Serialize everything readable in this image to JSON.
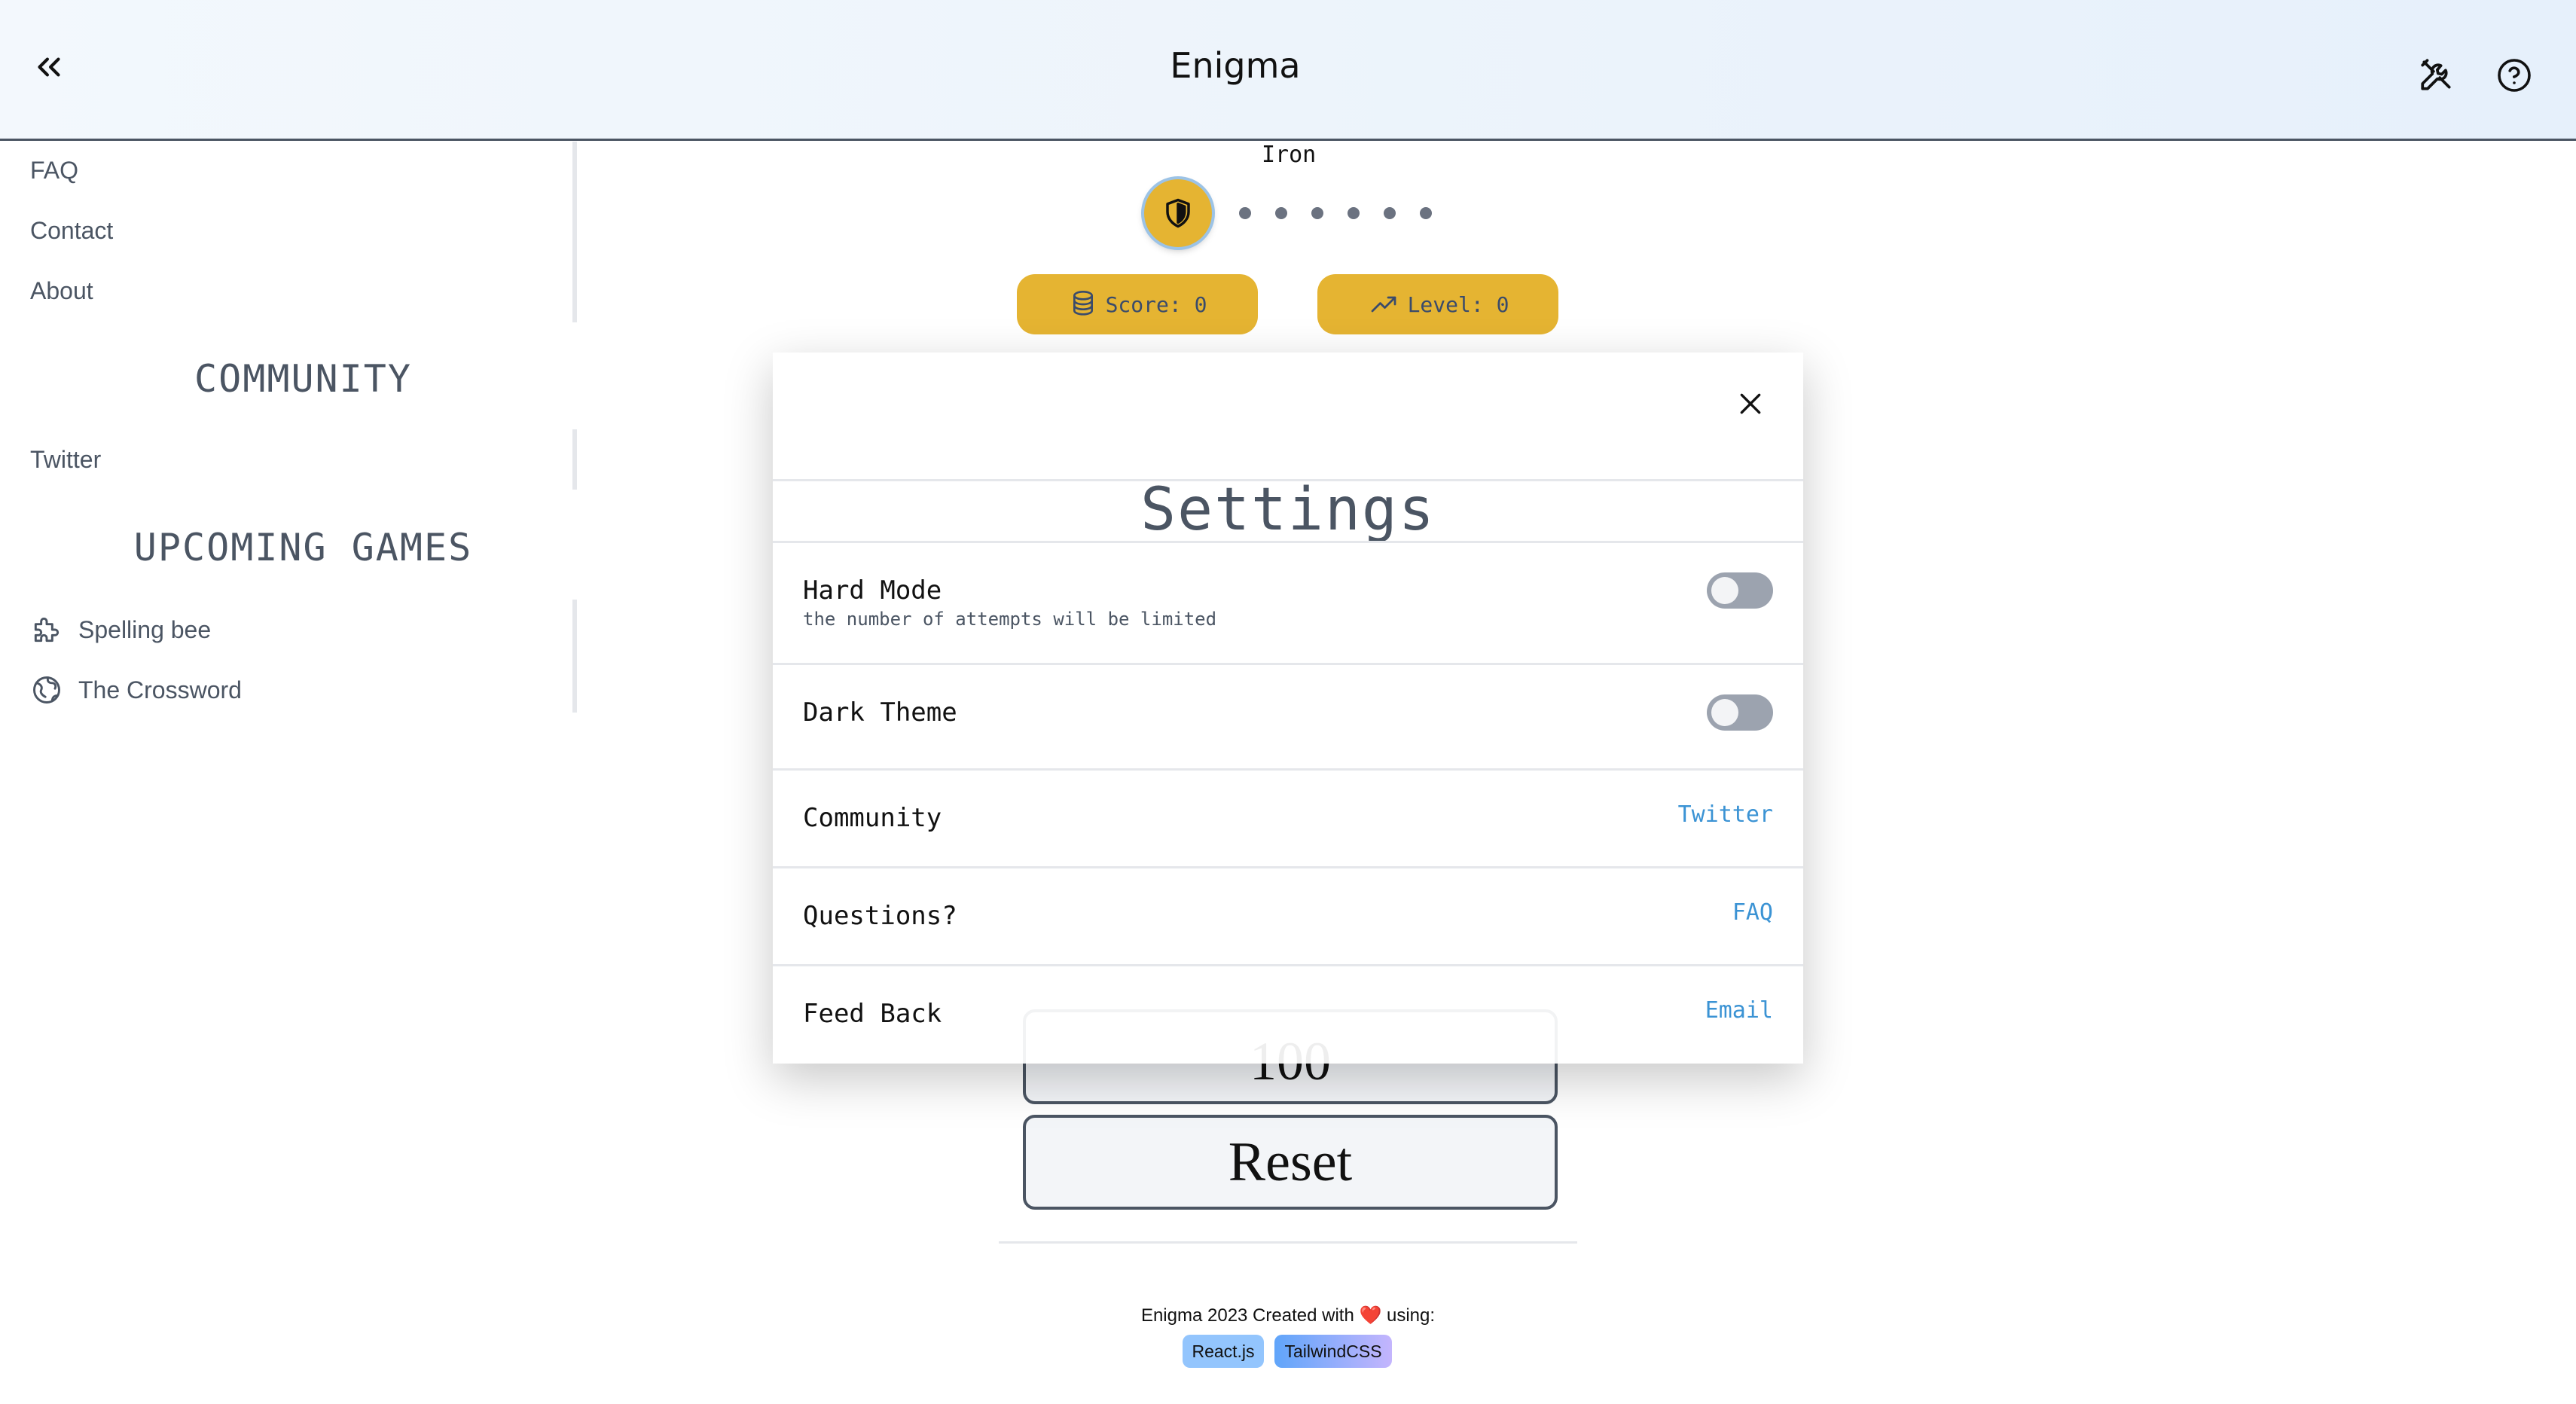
{
  "header": {
    "title": "Enigma",
    "back_icon": "double-chevron-left-icon",
    "tools_icon": "tools-icon",
    "help_icon": "help-circle-icon"
  },
  "sidebar": {
    "links": [
      "FAQ",
      "Contact",
      "About"
    ],
    "community_heading": "COMMUNITY",
    "community_links": [
      "Twitter"
    ],
    "upcoming_heading": "UPCOMING GAMES",
    "games": [
      {
        "label": "Spelling bee",
        "icon": "puzzle-icon"
      },
      {
        "label": "The Crossword",
        "icon": "globe-icon"
      }
    ]
  },
  "game": {
    "rank": "Iron",
    "progress_total_steps": 7,
    "progress_current_step": 1,
    "score_label": "Score: 0",
    "level_label": "Level: 0",
    "counter_value": "100",
    "reset_label": "Reset"
  },
  "settings": {
    "title": "Settings",
    "hard_mode": {
      "label": "Hard Mode",
      "description": "the number of attempts will be limited",
      "enabled": false
    },
    "dark_theme": {
      "label": "Dark Theme",
      "enabled": false
    },
    "community": {
      "label": "Community",
      "link": "Twitter"
    },
    "questions": {
      "label": "Questions?",
      "link": "FAQ"
    },
    "feedback": {
      "label": "Feed Back",
      "link": "Email"
    }
  },
  "footer": {
    "text": "Enigma 2023 Created with ❤️ using:",
    "badges": [
      "React.js",
      "TailwindCSS"
    ]
  },
  "colors": {
    "accent": "#E5B432",
    "link": "#3B93D4",
    "text_muted": "#4B5563"
  }
}
